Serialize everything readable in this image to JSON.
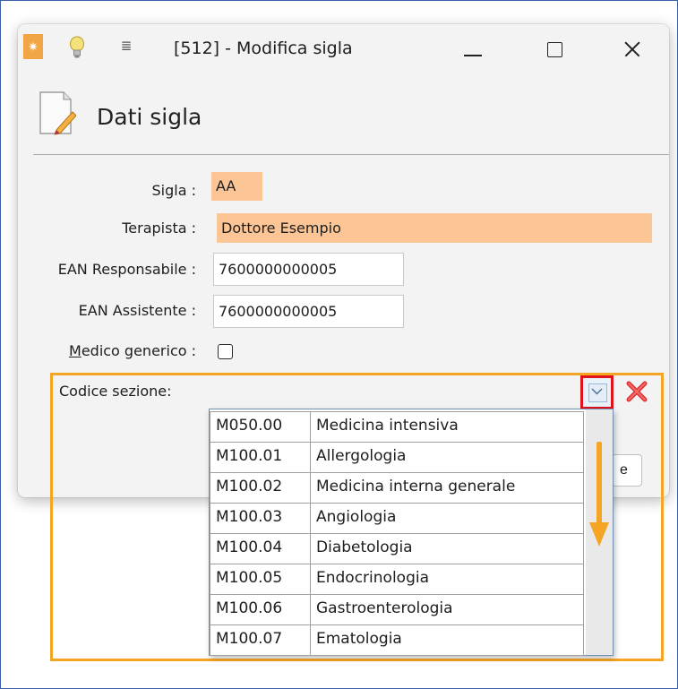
{
  "window": {
    "title": "[512] - Modifica sigla"
  },
  "header": {
    "title": "Dati sigla"
  },
  "form": {
    "sigla_label": "Sigla :",
    "sigla_value": "AA",
    "terapista_label": "Terapista :",
    "terapista_value": "Dottore Esempio",
    "ean_resp_label": "EAN Responsabile :",
    "ean_resp_value": "7600000000005",
    "ean_assist_label": "EAN Assistente :",
    "ean_assist_value": "7600000000005",
    "medico_label_first": "M",
    "medico_label_rest": "edico generico :",
    "medico_checked": false,
    "codice_label": "Codice sezione:",
    "codice_value": "",
    "partial_button_label": "e"
  },
  "dropdown": {
    "rows": [
      {
        "code": "M050.00",
        "name": "Medicina intensiva"
      },
      {
        "code": "M100.01",
        "name": "Allergologia"
      },
      {
        "code": "M100.02",
        "name": "Medicina interna generale"
      },
      {
        "code": "M100.03",
        "name": "Angiologia"
      },
      {
        "code": "M100.04",
        "name": "Diabetologia"
      },
      {
        "code": "M100.05",
        "name": "Endocrinologia"
      },
      {
        "code": "M100.06",
        "name": "Gastroenterologia"
      },
      {
        "code": "M100.07",
        "name": "Ematologia"
      }
    ]
  },
  "colors": {
    "highlight": "#f5a524",
    "field_required": "#fbc596",
    "dropdown_button_border": "#e0121a",
    "clear_icon": "#e03030"
  },
  "icons": {
    "app": "app-logo-icon",
    "bulb": "lightbulb-icon",
    "qat": "quick-access-menu-icon",
    "header": "document-edit-icon",
    "dropdown": "chevron-down-icon",
    "clear": "close-x-icon",
    "scroll_arrow": "arrow-down-icon"
  }
}
